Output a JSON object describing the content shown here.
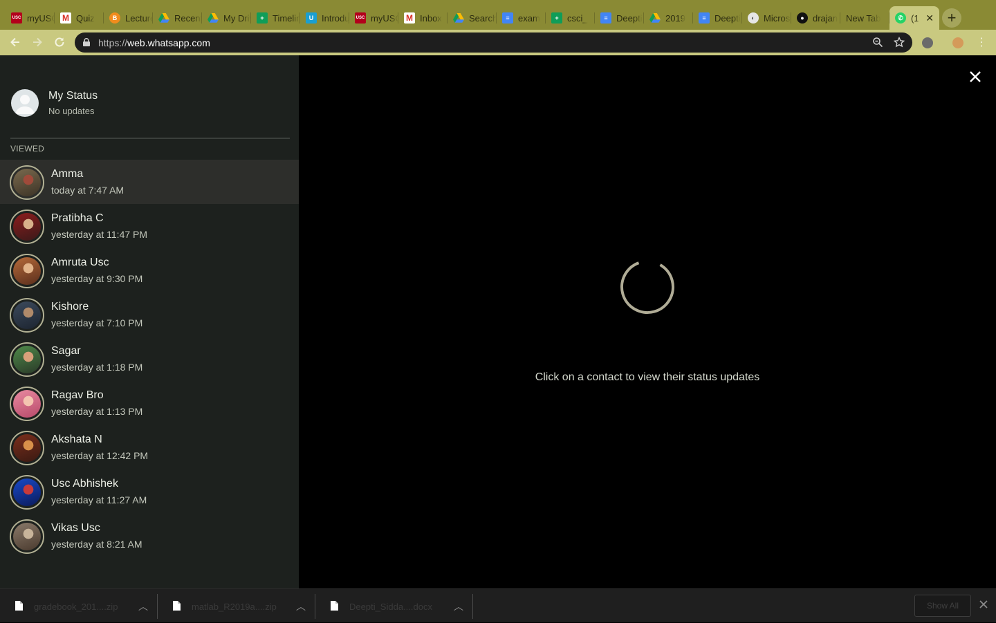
{
  "browser": {
    "tabs": [
      {
        "label": "myUSC",
        "icon": "usc-icon",
        "color": "#b3001b",
        "glyph": "USC"
      },
      {
        "label": "Quiz",
        "icon": "gmail-icon",
        "color": "#ffffff",
        "glyph": "M"
      },
      {
        "label": "Lecture",
        "icon": "bitcoin-icon",
        "color": "#f28c1d",
        "glyph": "B"
      },
      {
        "label": "Recent",
        "icon": "drive-icon",
        "color": "drive",
        "glyph": ""
      },
      {
        "label": "My Drive",
        "icon": "drive-icon",
        "color": "drive",
        "glyph": ""
      },
      {
        "label": "Timeline",
        "icon": "sheets-icon",
        "color": "#0f9d58",
        "glyph": "+"
      },
      {
        "label": "Introduction",
        "icon": "u-icon",
        "color": "#1a9fd1",
        "glyph": "U"
      },
      {
        "label": "myUSC",
        "icon": "usc-icon",
        "color": "#b3001b",
        "glyph": "USC"
      },
      {
        "label": "Inbox",
        "icon": "gmail-icon",
        "color": "#ffffff",
        "glyph": "M"
      },
      {
        "label": "Search",
        "icon": "drive-icon",
        "color": "drive",
        "glyph": ""
      },
      {
        "label": "exam",
        "icon": "docs-icon",
        "color": "#4285f4",
        "glyph": "≡"
      },
      {
        "label": "csci_",
        "icon": "sheets-icon",
        "color": "#0f9d58",
        "glyph": "+"
      },
      {
        "label": "Deepti",
        "icon": "docs-icon",
        "color": "#4285f4",
        "glyph": "≡"
      },
      {
        "label": "2019",
        "icon": "drive-icon",
        "color": "drive",
        "glyph": ""
      },
      {
        "label": "Deepti",
        "icon": "docs-icon",
        "color": "#4285f4",
        "glyph": "≡"
      },
      {
        "label": "Microsoft",
        "icon": "globe-icon",
        "color": "#e6e6e6",
        "glyph": "◐"
      },
      {
        "label": "drajan",
        "icon": "github-icon",
        "color": "#111111",
        "glyph": "●"
      },
      {
        "label": "New Tab",
        "icon": "",
        "color": "",
        "glyph": ""
      },
      {
        "label": "(1",
        "icon": "whatsapp-icon",
        "color": "#25d366",
        "glyph": "✆",
        "active": true
      }
    ],
    "url_scheme": "https://",
    "url_host": "web.whatsapp.com"
  },
  "my_status": {
    "name": "My Status",
    "subtitle": "No updates"
  },
  "section_label": "VIEWED",
  "contacts": [
    {
      "name": "Amma",
      "time": "today at 7:47 AM",
      "selected": true,
      "photo": [
        "#7a6a4e",
        "#3c3326",
        "#a04a3a"
      ]
    },
    {
      "name": "Pratibha C",
      "time": "yesterday at 11:47 PM",
      "photo": [
        "#8c1c1c",
        "#3a1a1a",
        "#d8b08a"
      ]
    },
    {
      "name": "Amruta Usc",
      "time": "yesterday at 9:30 PM",
      "photo": [
        "#b56a3a",
        "#5a2e1c",
        "#e2b48a"
      ]
    },
    {
      "name": "Kishore",
      "time": "yesterday at 7:10 PM",
      "photo": [
        "#3c4a5c",
        "#1c2430",
        "#b08a6a"
      ]
    },
    {
      "name": "Sagar",
      "time": "yesterday at 1:18 PM",
      "photo": [
        "#4f8a4a",
        "#2a3a28",
        "#d8a07a"
      ]
    },
    {
      "name": "Ragav Bro",
      "time": "yesterday at 1:13 PM",
      "photo": [
        "#e88aa0",
        "#b84a6a",
        "#f4c4b0"
      ]
    },
    {
      "name": "Akshata N",
      "time": "yesterday at 12:42 PM",
      "photo": [
        "#7a2e1c",
        "#3a1a12",
        "#d8904a"
      ]
    },
    {
      "name": "Usc Abhishek",
      "time": "yesterday at 11:27 AM",
      "photo": [
        "#1a4ac8",
        "#0a1a5a",
        "#c83a3a"
      ]
    },
    {
      "name": "Vikas Usc",
      "time": "yesterday at 8:21 AM",
      "photo": [
        "#8a7a6a",
        "#4a3a2e",
        "#c8b49a"
      ]
    }
  ],
  "viewer": {
    "hint": "Click on a contact to view their status updates"
  },
  "downloads": [
    {
      "name": "gradebook_201....zip"
    },
    {
      "name": "matlab_R2019a....zip"
    },
    {
      "name": "Deepti_Sidda....docx"
    }
  ],
  "shelf": {
    "show_all": "Show All"
  },
  "colors": {
    "tab_strip": "#8a8a34",
    "toolbar": "#c9c980",
    "panel": "#1d211e",
    "selected_row": "#2d2e2b",
    "ring": "#b2b194"
  }
}
